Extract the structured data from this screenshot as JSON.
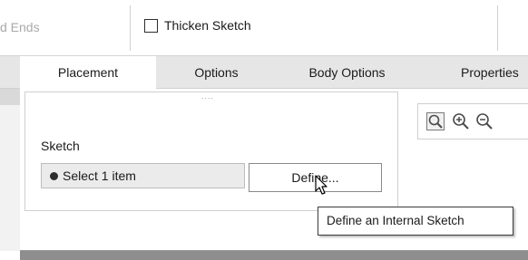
{
  "toolbar": {
    "ends_label": "d Ends",
    "thicken_label": "Thicken Sketch",
    "thicken_checked": false
  },
  "tabs": [
    {
      "label": "Placement",
      "active": true
    },
    {
      "label": "Options",
      "active": false
    },
    {
      "label": "Body Options",
      "active": false
    },
    {
      "label": "Properties",
      "active": false
    }
  ],
  "panel": {
    "grip": "....",
    "sketch_label": "Sketch",
    "select_field": "Select 1 item",
    "define_button": "Define..."
  },
  "zoom_icons": [
    "zoom-window-icon",
    "zoom-in-icon",
    "zoom-out-icon"
  ],
  "tooltip": "Define an Internal Sketch",
  "colors": {
    "tab_bar": "#e6e6e6",
    "field_bg": "#ebebeb",
    "icon": "#4a4a4a"
  }
}
